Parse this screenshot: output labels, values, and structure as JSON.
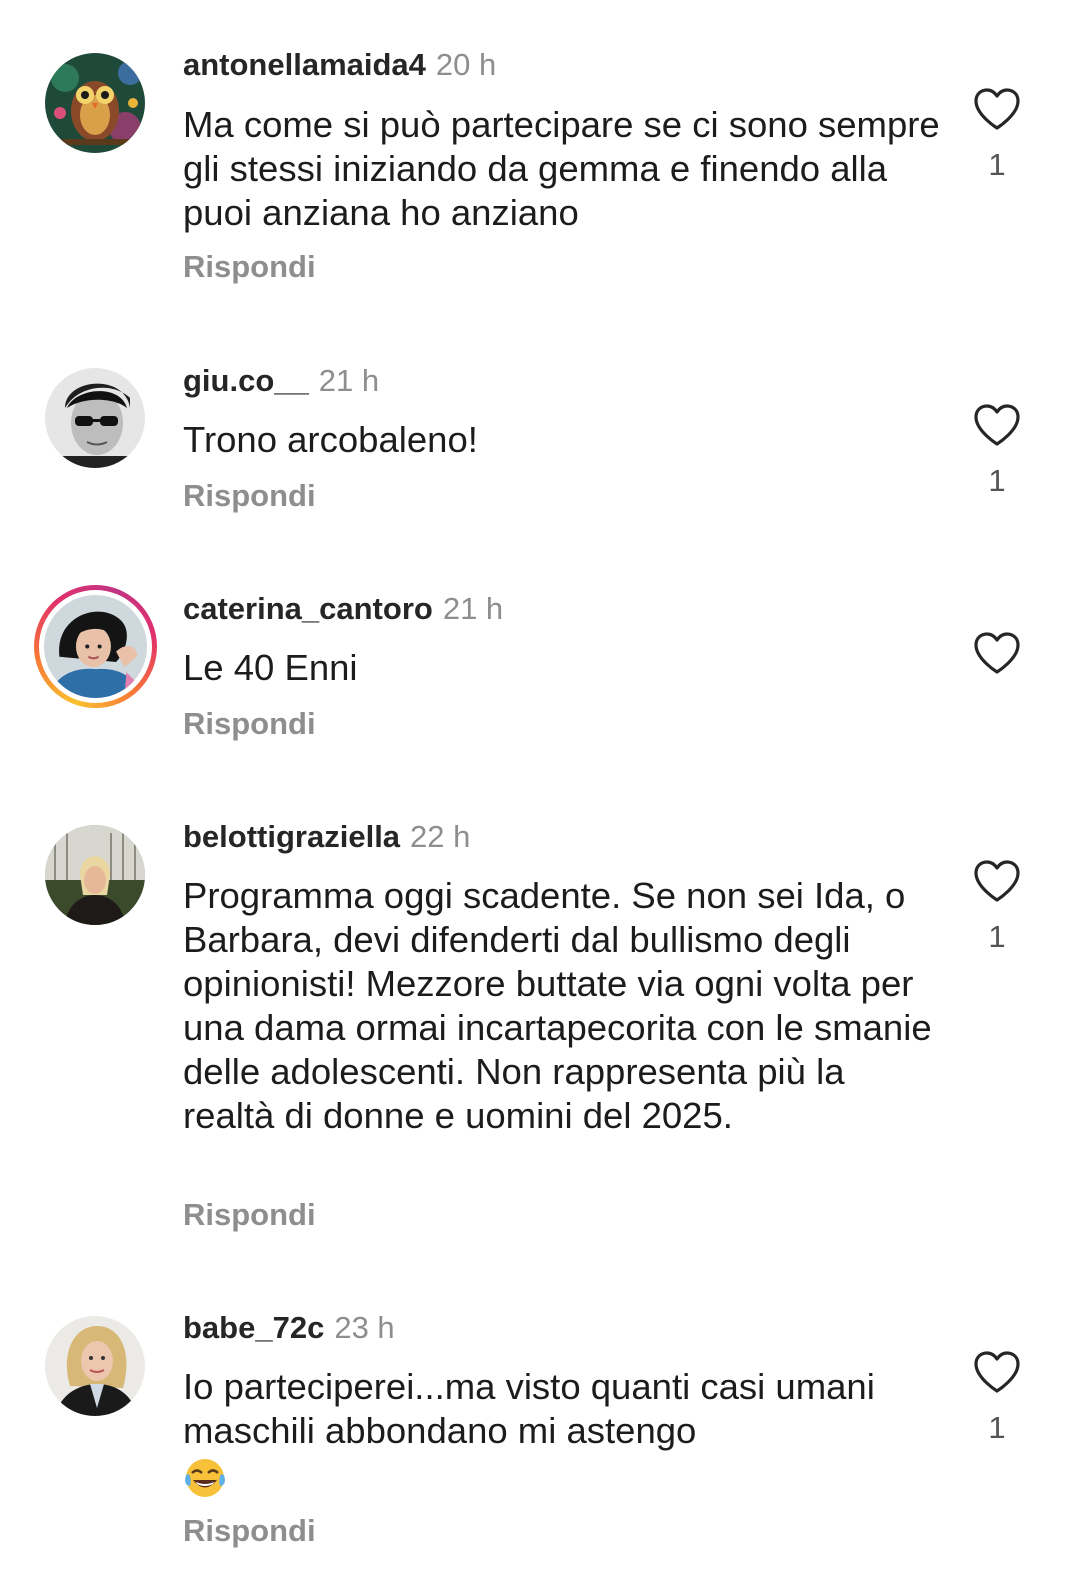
{
  "comments": [
    {
      "username": "antonellamaida4",
      "time": "20 h",
      "text": "Ma come si può partecipare se ci sono sempre gli stessi iniziando da gemma e finendo alla puoi anziana ho anziano",
      "reply_label": "Rispondi",
      "likes": "1",
      "avatar": "owl-illustration-avatar"
    },
    {
      "username": "giu.co__",
      "time": "21 h",
      "text": "Trono arcobaleno!",
      "reply_label": "Rispondi",
      "likes": "1",
      "avatar": "bw-sunglasses-avatar"
    },
    {
      "username": "caterina_cantoro",
      "time": "21 h",
      "text": "Le 40 Enni",
      "reply_label": "Rispondi",
      "likes": "",
      "avatar": "story-ring-avatar"
    },
    {
      "username": "belottigraziella",
      "time": "22 h",
      "text": "Programma oggi scadente. Se non sei Ida, o Barbara, devi difenderti dal bullismo degli opinionisti! Mezzore buttate via ogni volta per una dama ormai incartapecorita con le smanie delle adolescenti. Non rappresenta più la realtà di donne e uomini del 2025.",
      "reply_label": "Rispondi",
      "likes": "1",
      "avatar": "woman-cathedral-avatar"
    },
    {
      "username": "babe_72c",
      "time": "23 h",
      "text": "Io parteciperei...ma visto quanti casi umani  maschili abbondano mi astengo",
      "emoji": "face-with-tears-of-joy",
      "reply_label": "Rispondi",
      "likes": "1",
      "avatar": "blonde-woman-avatar"
    }
  ],
  "colors": {
    "username": "#262626",
    "secondary": "#8e8e8e",
    "text": "#1c1c1c",
    "heart_outline": "#262626"
  },
  "icons": {
    "like": "heart-outline-icon"
  }
}
